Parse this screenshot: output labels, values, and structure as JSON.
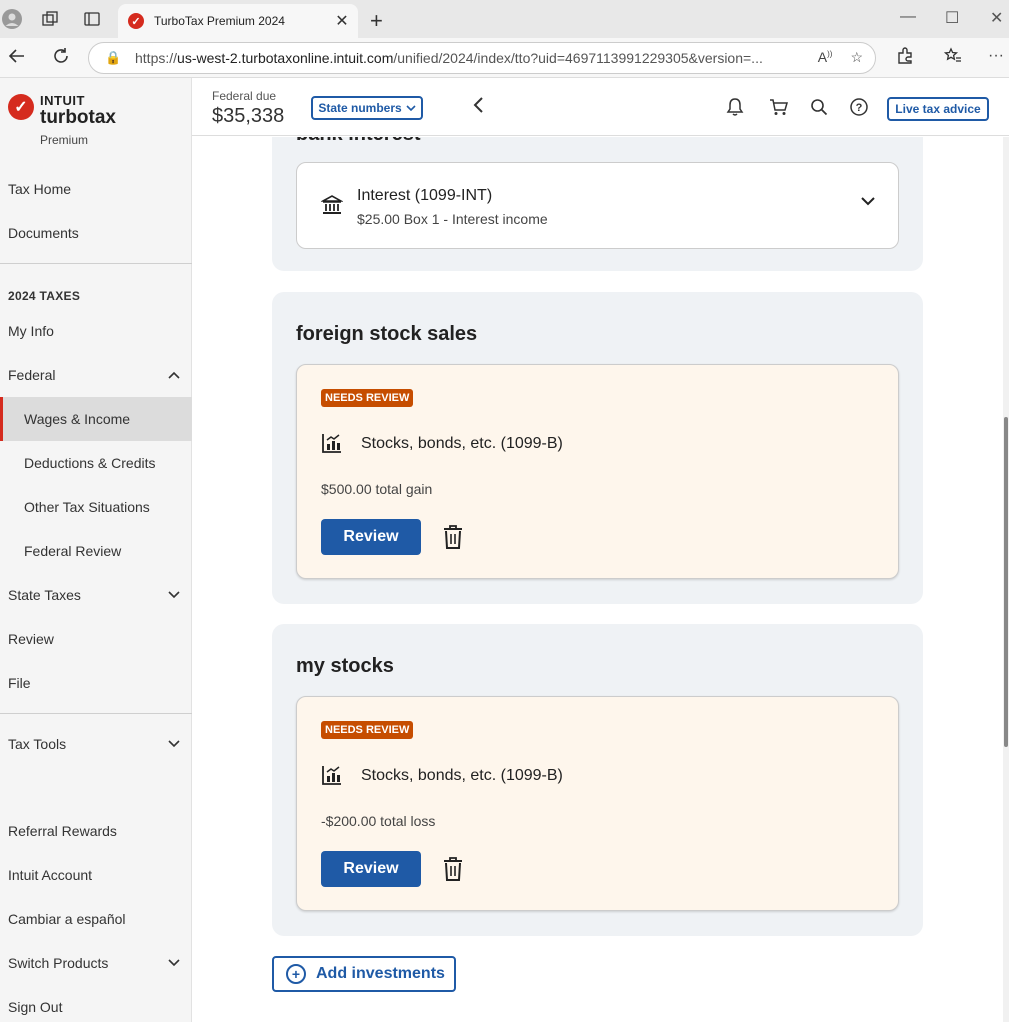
{
  "browser": {
    "tab_title": "TurboTax Premium 2024",
    "url_prefix": "https://",
    "url_host": "us-west-2.turbotaxonline.intuit.com",
    "url_path": "/unified/2024/index/tto?uid=4697113991229305&version=..."
  },
  "logo": {
    "intuit": "INTUIT",
    "turbotax": "turbotax",
    "edition": "Premium"
  },
  "sidebar": {
    "items_top": [
      "Tax Home",
      "Documents"
    ],
    "section_label": "2024 TAXES",
    "my_info": "My Info",
    "federal": "Federal",
    "federal_sub": [
      "Wages & Income",
      "Deductions & Credits",
      "Other Tax Situations",
      "Federal Review"
    ],
    "state_taxes": "State Taxes",
    "review": "Review",
    "file": "File",
    "tax_tools": "Tax Tools",
    "bottom": [
      "Referral Rewards",
      "Intuit Account",
      "Cambiar a español",
      "Switch Products",
      "Sign Out"
    ]
  },
  "header": {
    "federal_due_label": "Federal due",
    "federal_due_amount": "$35,338",
    "state_numbers": "State numbers",
    "live_tax_advice": "Live tax advice"
  },
  "groups": [
    {
      "title": "bank interest",
      "card": {
        "title": "Interest (1099-INT)",
        "subtitle": "$25.00 Box 1 - Interest income"
      }
    },
    {
      "title": "foreign stock sales",
      "card": {
        "badge": "NEEDS REVIEW",
        "title": "Stocks, bonds, etc. (1099-B)",
        "subtitle": "$500.00 total gain",
        "button": "Review"
      }
    },
    {
      "title": "my stocks",
      "card": {
        "badge": "NEEDS REVIEW",
        "title": "Stocks, bonds, etc. (1099-B)",
        "subtitle": "-$200.00 total loss",
        "button": "Review"
      }
    }
  ],
  "add_investments": "Add investments",
  "colors": {
    "brand_red": "#d52b1e",
    "action_blue": "#1f5aa6",
    "badge_orange": "#c64d00",
    "review_card_bg": "#fef6ec",
    "group_bg": "#eff2f5"
  }
}
